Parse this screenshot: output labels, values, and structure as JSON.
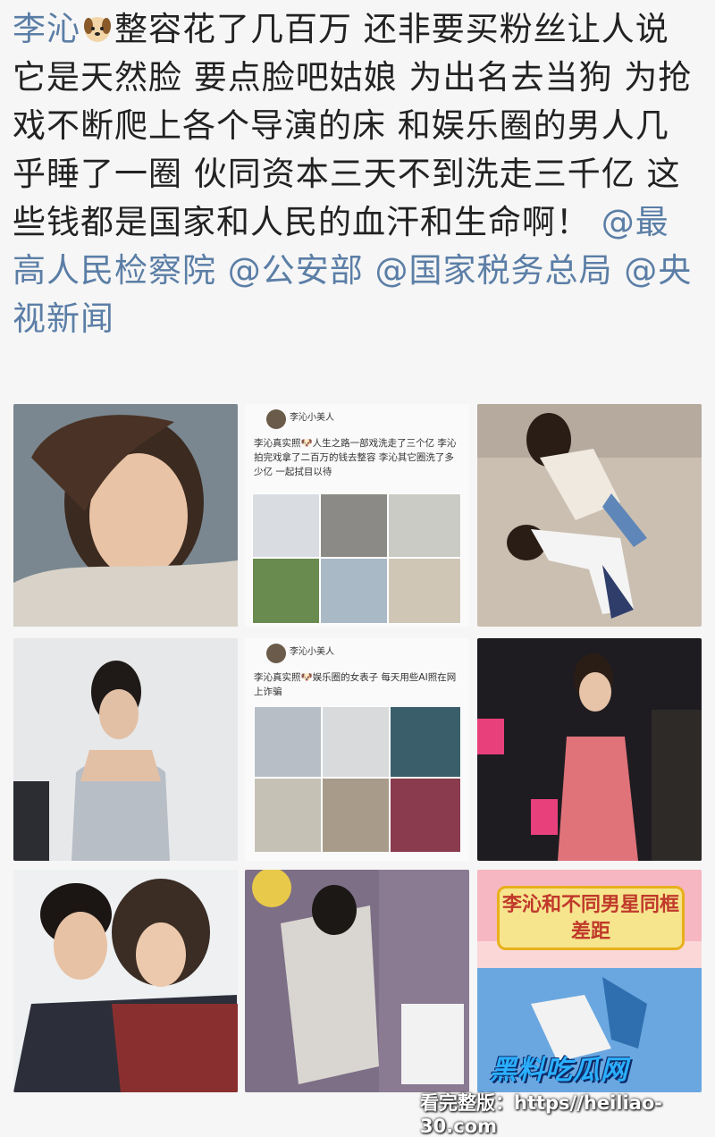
{
  "post": {
    "author": "李沁",
    "emoji_icon": "dog-face-icon",
    "body": "整容花了几百万 还非要买粉丝让人说它是天然脸 要点脸吧姑娘 为出名去当狗 为抢戏不断爬上各个导演的床 和娱乐圈的男人几乎睡了一圈 伙同资本三天不到洗走三千亿 这些钱都是国家和人民的血汗和生命啊！",
    "mentions": [
      "@最高人民检察院",
      "@公安部",
      "@国家税务总局",
      "@央视新闻"
    ]
  },
  "images": {
    "cell_2": {
      "account": "李沁小美人",
      "text": "李沁真实照🐶人生之路一部戏洗走了三个亿 李沁拍完戏拿了二百万的钱去整容 李沁其它圈洗了多少亿 一起拭目以待"
    },
    "cell_5": {
      "account": "李沁小美人",
      "text": "李沁真实照🐶娱乐圈的女表子 每天用些AI照在网上诈骗"
    },
    "cell_9": {
      "caption": "李沁和不同男星同框差距"
    }
  },
  "watermark": {
    "logo_text": "黑料吃瓜网",
    "url_text": "看完整版：https//heiliao-30.com"
  }
}
